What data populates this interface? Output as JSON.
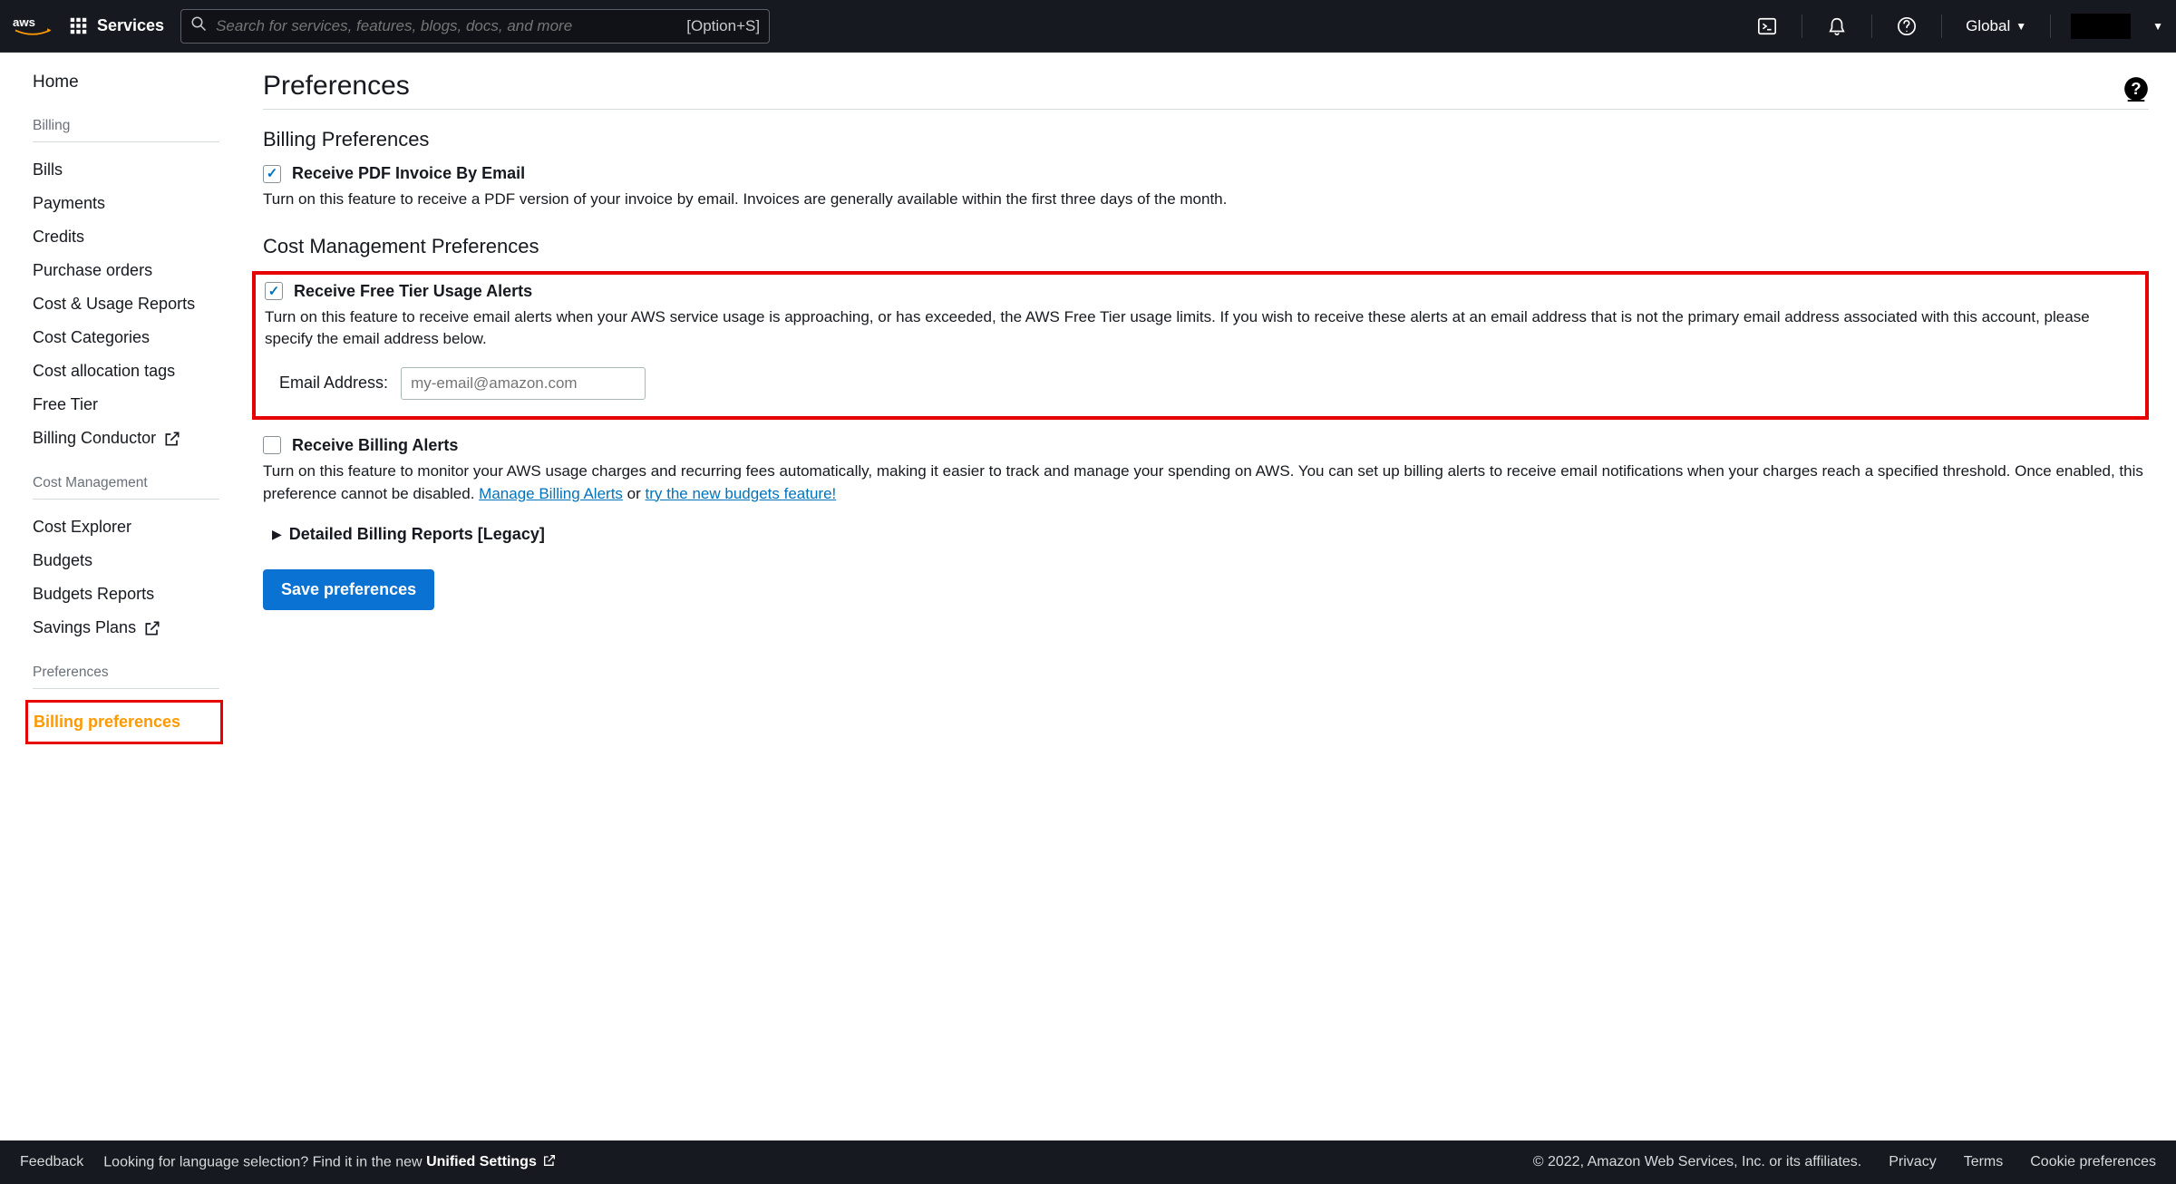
{
  "header": {
    "services_label": "Services",
    "search_placeholder": "Search for services, features, blogs, docs, and more",
    "search_hotkey": "[Option+S]",
    "region": "Global"
  },
  "sidebar": {
    "home": "Home",
    "billing_head": "Billing",
    "billing_items": [
      "Bills",
      "Payments",
      "Credits",
      "Purchase orders",
      "Cost & Usage Reports",
      "Cost Categories",
      "Cost allocation tags",
      "Free Tier",
      "Billing Conductor"
    ],
    "cm_head": "Cost Management",
    "cm_items": [
      "Cost Explorer",
      "Budgets",
      "Budgets Reports",
      "Savings Plans"
    ],
    "pref_head": "Preferences",
    "pref_items": [
      "Billing preferences"
    ]
  },
  "page": {
    "title": "Preferences",
    "billing_section": "Billing Preferences",
    "cm_section": "Cost Management Preferences",
    "pdf": {
      "title": "Receive PDF Invoice By Email",
      "desc": "Turn on this feature to receive a PDF version of your invoice by email. Invoices are generally available within the first three days of the month."
    },
    "free_tier": {
      "title": "Receive Free Tier Usage Alerts",
      "desc": "Turn on this feature to receive email alerts when your AWS service usage is approaching, or has exceeded, the AWS Free Tier usage limits. If you wish to receive these alerts at an email address that is not the primary email address associated with this account, please specify the email address below.",
      "email_label": "Email Address:",
      "email_placeholder": "my-email@amazon.com"
    },
    "billing_alerts": {
      "title": "Receive Billing Alerts",
      "desc_prefix": "Turn on this feature to monitor your AWS usage charges and recurring fees automatically, making it easier to track and manage your spending on AWS. You can set up billing alerts to receive email notifications when your charges reach a specified threshold. Once enabled, this preference cannot be disabled. ",
      "link1": "Manage Billing Alerts",
      "or": " or ",
      "link2": "try the new budgets feature!"
    },
    "legacy": "Detailed Billing Reports [Legacy]",
    "save": "Save preferences"
  },
  "footer": {
    "feedback": "Feedback",
    "lang_prompt_prefix": "Looking for language selection? Find it in the new ",
    "lang_prompt_link": "Unified Settings",
    "copyright": "© 2022, Amazon Web Services, Inc. or its affiliates.",
    "privacy": "Privacy",
    "terms": "Terms",
    "cookies": "Cookie preferences"
  }
}
